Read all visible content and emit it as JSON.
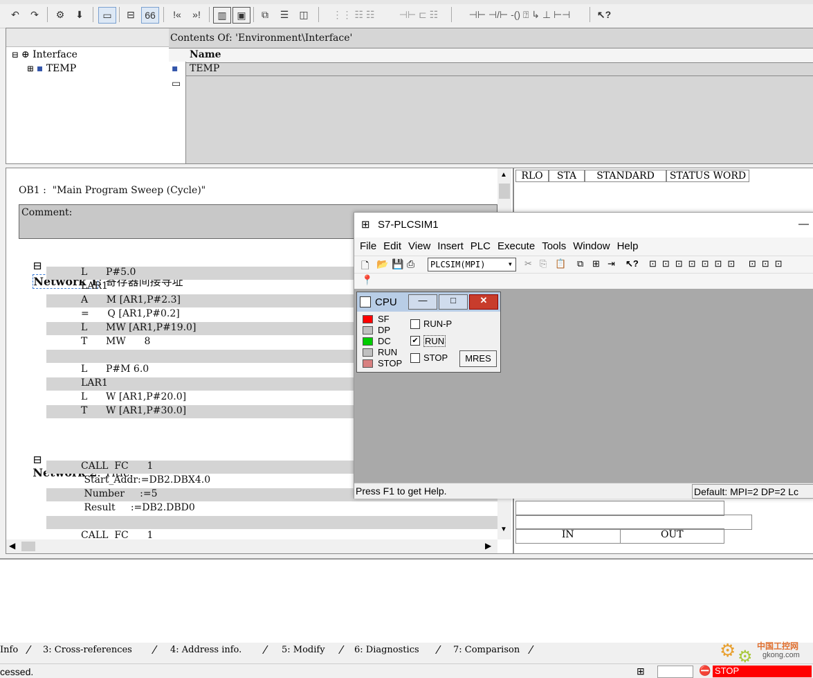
{
  "toolbar": {
    "icons": [
      "undo-icon",
      "redo-icon",
      "settings-icon",
      "download-icon",
      "program-icon",
      "network-icon",
      "glasses-icon",
      "prev-icon",
      "next-icon",
      "overview-icon",
      "monitor-icon",
      "cascade-icon",
      "tile-h-icon",
      "tile-v-icon",
      "ladder-icons",
      "help-icon"
    ]
  },
  "interface_tree": {
    "root_label": "Interface",
    "child_label": "TEMP"
  },
  "contents": {
    "title": "Contents Of: 'Environment\\Interface'",
    "column_name": "Name",
    "row1": "TEMP"
  },
  "editor": {
    "block_title": "OB1 :  \"Main Program Sweep (Cycle)\"",
    "comment_label": "Comment:",
    "network1_label": "Network 1",
    "network1_title": ": 寄存器间接寻址",
    "network1_lines": [
      "L      P#5.0",
      "LAR1",
      "A      M [AR1,P#2.3]",
      "=      Q [AR1,P#0.2]",
      "L      MW [AR1,P#19.0]",
      "T      MW      8",
      "",
      "L      P#M 6.0",
      "LAR1",
      "L      W [AR1,P#20.0]",
      "T      W [AR1,P#30.0]"
    ],
    "network2_label": "Network 2",
    "network2_title": ": Title:",
    "network2_lines": [
      "CALL  FC      1",
      " Start_Addr:=DB2.DBX4.0",
      " Number     :=5",
      " Result     :=DB2.DBD0",
      "",
      "CALL  FC      1"
    ]
  },
  "status_table": {
    "headers": [
      "RLO",
      "STA",
      "STANDARD",
      "STATUS WORD"
    ],
    "in_label": "IN",
    "out_label": "OUT"
  },
  "plcsim": {
    "title": "S7-PLCSIM1",
    "minimize": "—",
    "menu": [
      "File",
      "Edit",
      "View",
      "Insert",
      "PLC",
      "Execute",
      "Tools",
      "Window",
      "Help"
    ],
    "interface_select": "PLCSIM(MPI)",
    "status_left": "Press F1 to get Help.",
    "status_right": "Default:  MPI=2 DP=2 Lc"
  },
  "cpu": {
    "title": "CPU",
    "leds": [
      {
        "label": "SF",
        "color": "#ff0000"
      },
      {
        "label": "DP",
        "color": "#c0c0c0"
      },
      {
        "label": "DC",
        "color": "#00cc00"
      },
      {
        "label": "RUN",
        "color": "#c0c0c0"
      },
      {
        "label": "STOP",
        "color": "#d88080"
      }
    ],
    "mode_run_p": "RUN-P",
    "mode_run": "RUN",
    "mode_stop": "STOP",
    "mres": "MRES"
  },
  "tabs": [
    "Info",
    "3: Cross-references",
    "4: Address info.",
    "5: Modify",
    "6: Diagnostics",
    "7: Comparison"
  ],
  "statusbar": {
    "left": "cessed.",
    "stop": "STOP",
    "watermark_title": "中国工控网",
    "watermark_url": "gkong.com"
  }
}
